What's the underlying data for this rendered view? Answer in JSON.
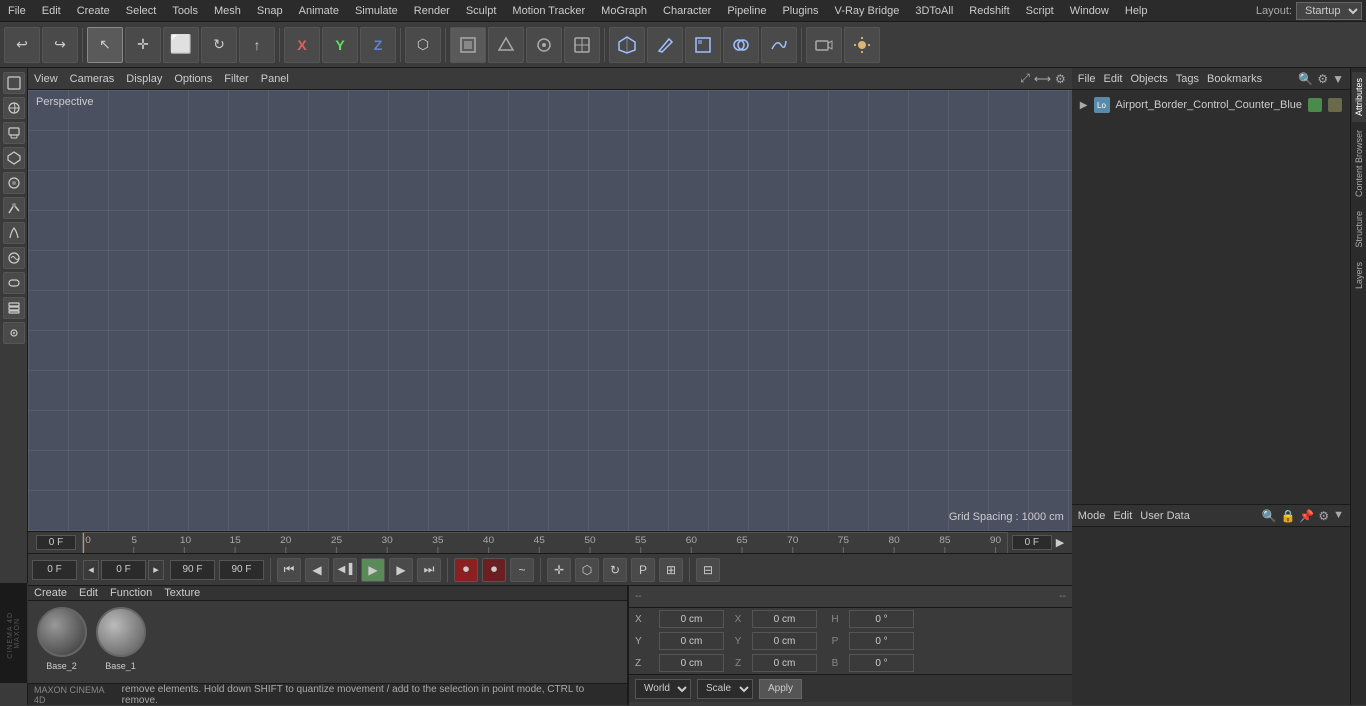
{
  "menubar": {
    "items": [
      "File",
      "Edit",
      "Create",
      "Select",
      "Tools",
      "Mesh",
      "Snap",
      "Animate",
      "Simulate",
      "Render",
      "Sculpt",
      "Motion Tracker",
      "MoGraph",
      "Character",
      "Pipeline",
      "Plugins",
      "V-Ray Bridge",
      "3DToAll",
      "Redshift",
      "Script",
      "Window",
      "Help"
    ],
    "layout_label": "Layout:",
    "layout_value": "Startup"
  },
  "toolbar": {
    "undo_label": "↩",
    "transform_tools": [
      "↖",
      "+",
      "⬜",
      "↻",
      "↑"
    ],
    "axis_x": "X",
    "axis_y": "Y",
    "axis_z": "Z",
    "snap_tools": [
      "⬡"
    ],
    "mode_tools": [
      "⬛",
      "▷",
      "◉",
      "⬚",
      "🎥",
      "💡"
    ]
  },
  "viewport": {
    "label": "Perspective",
    "view_menus": [
      "View",
      "Cameras",
      "Display",
      "Options",
      "Filter",
      "Panel"
    ],
    "grid_spacing": "Grid Spacing : 1000 cm"
  },
  "timeline": {
    "current_frame": "0 F",
    "end_frame": "0 F",
    "start": "0",
    "ticks": [
      "0",
      "5",
      "10",
      "15",
      "20",
      "25",
      "30",
      "35",
      "40",
      "45",
      "50",
      "55",
      "60",
      "65",
      "70",
      "75",
      "80",
      "85",
      "90"
    ]
  },
  "playback": {
    "start_field": "0 F",
    "current_field": "0 F",
    "end_field_1": "90 F",
    "end_field_2": "90 F"
  },
  "object_manager": {
    "menus": [
      "File",
      "Edit",
      "Objects",
      "Tags",
      "Bookmarks"
    ],
    "objects": [
      {
        "name": "Airport_Border_Control_Counter_Blue",
        "icon": "Lo",
        "badge": true
      }
    ]
  },
  "attributes": {
    "menus": [
      "Mode",
      "Edit",
      "User Data"
    ],
    "rows": [
      {
        "label": "X",
        "value1": "0 cm",
        "extra_label": "H",
        "extra_value": "0 °"
      },
      {
        "label": "Y",
        "value1": "0 cm",
        "extra_label": "P",
        "extra_value": "0 °"
      },
      {
        "label": "Z",
        "value1": "0 cm",
        "extra_label": "B",
        "extra_value": "0 °"
      },
      {
        "label2": "X",
        "value2": "0 cm"
      }
    ],
    "coord_rows": [
      {
        "axis": "X",
        "pos": "0 cm",
        "extra": "X",
        "extra_val": "0 cm",
        "flag": "H",
        "flag_val": "0 °"
      },
      {
        "axis": "Y",
        "pos": "0 cm",
        "extra": "Y",
        "extra_val": "0 cm",
        "flag": "P",
        "flag_val": "0 °"
      },
      {
        "axis": "Z",
        "pos": "0 cm",
        "extra": "Z",
        "extra_val": "0 cm",
        "flag": "B",
        "flag_val": "0 °"
      }
    ]
  },
  "transform_bar": {
    "world_label": "World",
    "scale_label": "Scale",
    "apply_label": "Apply"
  },
  "materials": {
    "menus": [
      "Create",
      "Edit",
      "Function",
      "Texture"
    ],
    "items": [
      {
        "name": "Base_2",
        "color": "#666"
      },
      {
        "name": "Base_1",
        "color": "#888"
      }
    ]
  },
  "status_bar": {
    "message": "remove elements. Hold down SHIFT to quantize movement / add to the selection in point mode, CTRL to remove."
  },
  "right_tabs": [
    "Attributes",
    "Content Browser",
    "Structure",
    "Layers"
  ],
  "icons": {
    "undo": "↩",
    "redo": "↪",
    "move": "✛",
    "scale": "⤡",
    "rotate": "↻",
    "play": "▶",
    "stop": "⏹",
    "prev": "⏮",
    "next": "⏭",
    "back": "◀",
    "fwd": "▶",
    "record": "⏺",
    "auto": "⏺",
    "motion": "~",
    "playback": "▶"
  }
}
